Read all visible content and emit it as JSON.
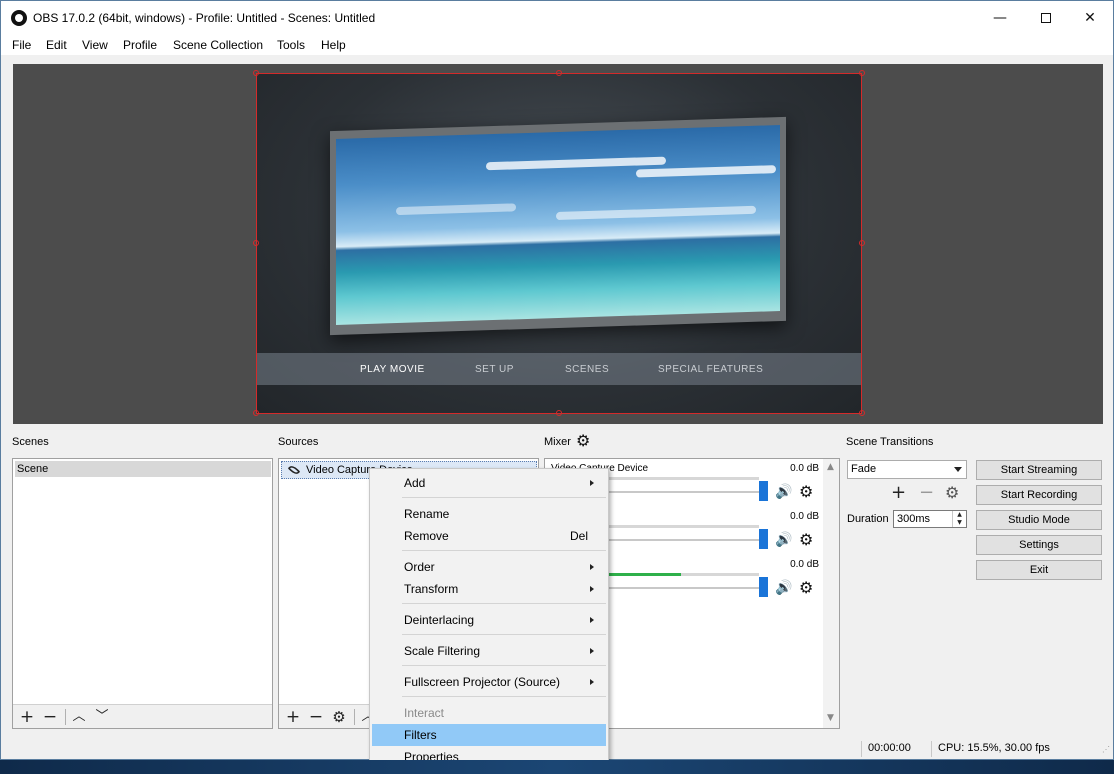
{
  "window": {
    "title": "OBS 17.0.2 (64bit, windows) - Profile: Untitled - Scenes: Untitled",
    "minimize": "—",
    "close": "✕"
  },
  "menubar": {
    "items": [
      "File",
      "Edit",
      "View",
      "Profile",
      "Scene Collection",
      "Tools",
      "Help"
    ]
  },
  "preview": {
    "dvd_menu": [
      "PLAY MOVIE",
      "SET UP",
      "SCENES",
      "SPECIAL FEATURES"
    ],
    "selection_color": "#d42a2a"
  },
  "scenes": {
    "label": "Scenes",
    "items": [
      "Scene"
    ]
  },
  "sources": {
    "label": "Sources",
    "items": [
      "Video Capture Device"
    ]
  },
  "mixer": {
    "label": "Mixer",
    "channels": [
      {
        "name": "Video Capture Device",
        "db": "0.0 dB",
        "level": 0.0
      },
      {
        "name": "",
        "db": "0.0 dB",
        "level": 0.0
      },
      {
        "name": "",
        "db": "0.0 dB",
        "level": 0.3
      }
    ]
  },
  "scene_transitions": {
    "label": "Scene Transitions",
    "selected": "Fade",
    "duration_label": "Duration",
    "duration_value": "300ms"
  },
  "controls": {
    "start_streaming": "Start Streaming",
    "start_recording": "Start Recording",
    "studio_mode": "Studio Mode",
    "settings": "Settings",
    "exit": "Exit"
  },
  "status": {
    "time": "00:00:00",
    "cpu": "CPU: 15.5%, 30.00 fps"
  },
  "context_menu": {
    "add": "Add",
    "rename": "Rename",
    "remove": "Remove",
    "remove_shortcut": "Del",
    "order": "Order",
    "transform": "Transform",
    "deinterlacing": "Deinterlacing",
    "scale_filtering": "Scale Filtering",
    "fullscreen_projector": "Fullscreen Projector (Source)",
    "interact": "Interact",
    "filters": "Filters",
    "properties": "Properties"
  },
  "icons": {
    "app": "obs-logo-icon",
    "visibility": "eye-icon",
    "speaker": "speaker-icon",
    "gear": "gear-icon"
  }
}
